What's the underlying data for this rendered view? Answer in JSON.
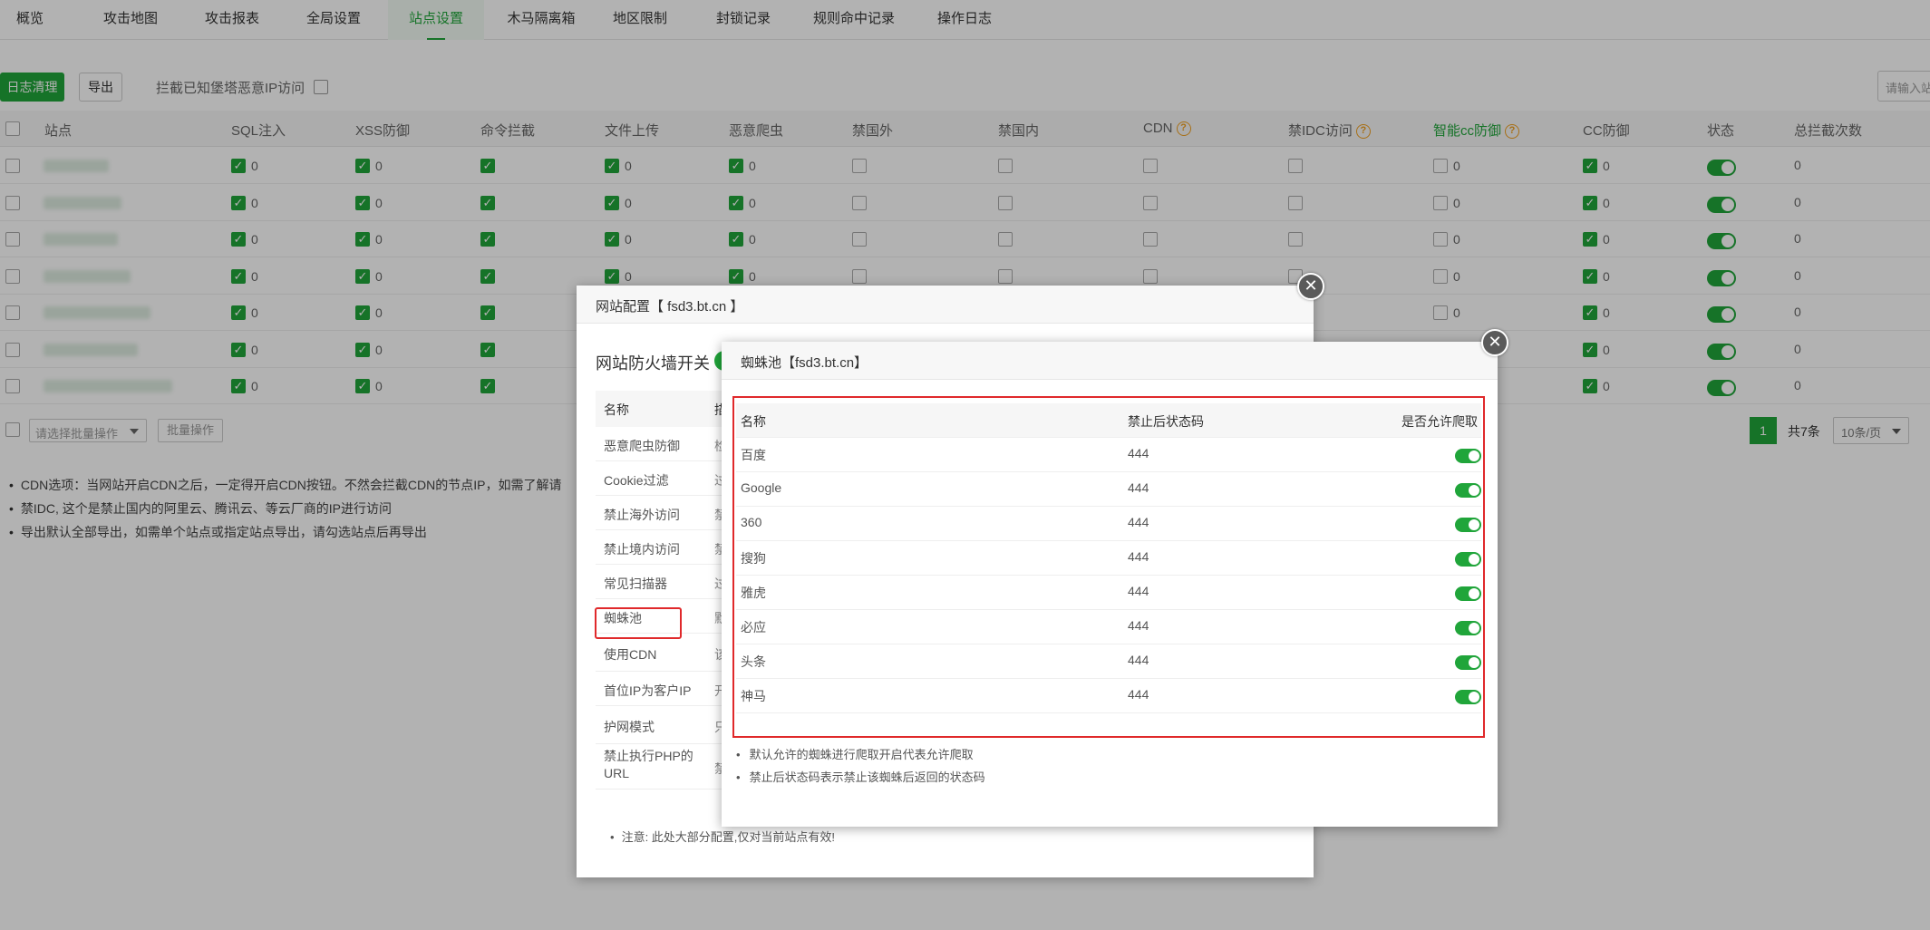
{
  "nav": {
    "tabs": [
      "概览",
      "攻击地图",
      "攻击报表",
      "全局设置",
      "站点设置",
      "木马隔离箱",
      "地区限制",
      "封锁记录",
      "规则命中记录",
      "操作日志"
    ],
    "active": "站点设置"
  },
  "toolbar": {
    "log_clean": "日志清理",
    "export": "导出",
    "block_label": "拦截已知堡塔恶意IP访问",
    "search_placeholder": "请输入站"
  },
  "table": {
    "headers": [
      "站点",
      "SQL注入",
      "XSS防御",
      "命令拦截",
      "文件上传",
      "恶意爬虫",
      "禁国外",
      "禁国内",
      "CDN",
      "禁IDC访问",
      "智能cc防御",
      "CC防御",
      "状态",
      "总拦截次数"
    ],
    "zero": "0",
    "total": "0"
  },
  "bottom": {
    "batch_select": "请选择批量操作",
    "batch_button": "批量操作",
    "page": "1",
    "total": "共7条",
    "per_page": "10条/页"
  },
  "notes": [
    "CDN选项：当网站开启CDN之后，一定得开启CDN按钮。不然会拦截CDN的节点IP，如需了解请",
    "禁IDC, 这个是禁止国内的阿里云、腾讯云、等云厂商的IP进行访问",
    "导出默认全部导出，如需单个站点或指定站点导出，请勾选站点后再导出"
  ],
  "dialog1": {
    "title": "网站配置【 fsd3.bt.cn 】",
    "firewall_label": "网站防火墙开关",
    "col_name": "名称",
    "col_desc": "描",
    "items": [
      {
        "name": "恶意爬虫防御",
        "frag": "检"
      },
      {
        "name": "Cookie过滤",
        "frag": "过"
      },
      {
        "name": "禁止海外访问",
        "frag": "禁"
      },
      {
        "name": "禁止境内访问",
        "frag": "禁"
      },
      {
        "name": "常见扫描器",
        "frag": "过"
      },
      {
        "name": "蜘蛛池",
        "frag": "默"
      },
      {
        "name": "使用CDN",
        "frag": "该"
      },
      {
        "name": "首位IP为客户IP",
        "frag": "开"
      },
      {
        "name": "护网模式",
        "frag": "只"
      },
      {
        "name": "禁止执行PHP的URL",
        "frag": "禁"
      }
    ],
    "note": "注意: 此处大部分配置,仅对当前站点有效!"
  },
  "dialog2": {
    "title": "蜘蛛池【fsd3.bt.cn】",
    "col_name": "名称",
    "col_code": "禁止后状态码",
    "col_allow": "是否允许爬取",
    "spiders": [
      {
        "name": "百度",
        "code": "444"
      },
      {
        "name": "Google",
        "code": "444"
      },
      {
        "name": "360",
        "code": "444"
      },
      {
        "name": "搜狗",
        "code": "444"
      },
      {
        "name": "雅虎",
        "code": "444"
      },
      {
        "name": "必应",
        "code": "444"
      },
      {
        "name": "头条",
        "code": "444"
      },
      {
        "name": "神马",
        "code": "444"
      }
    ],
    "tips": [
      "默认允许的蜘蛛进行爬取开启代表允许爬取",
      "禁止后状态码表示禁止该蜘蛛后返回的状态码"
    ]
  },
  "colors": {
    "accent": "#20a53a",
    "highlight": "#e0292b"
  }
}
